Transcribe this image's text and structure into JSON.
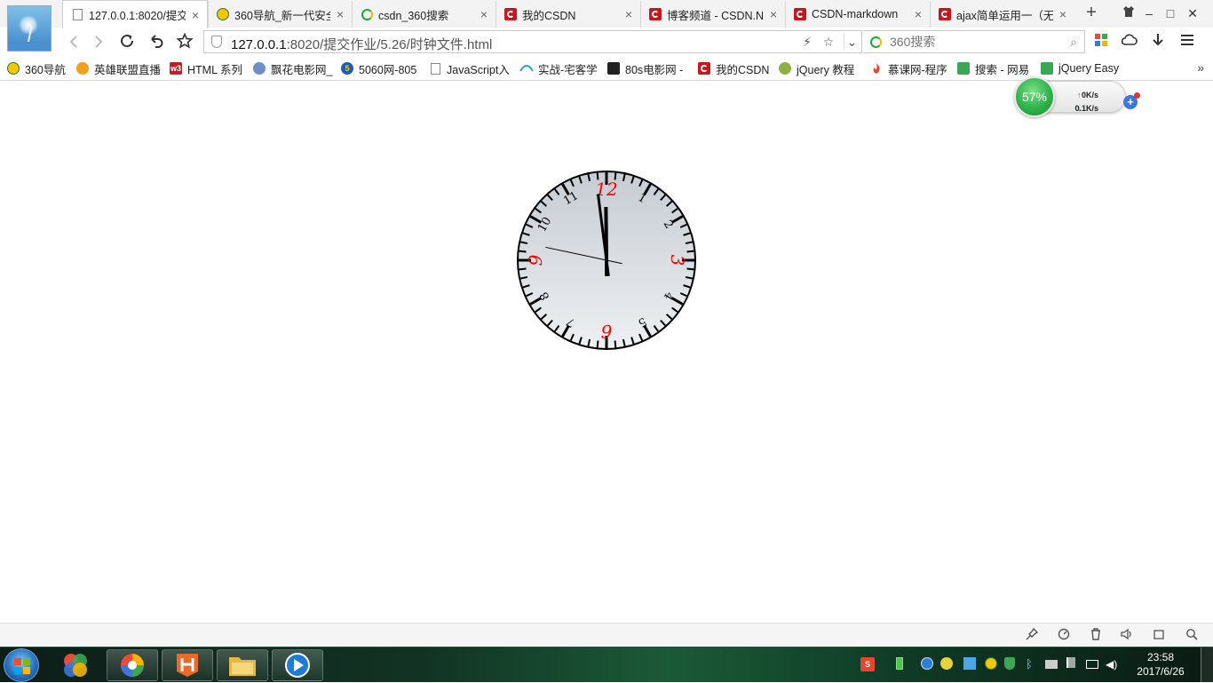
{
  "browser": {
    "tabs": [
      {
        "label": "127.0.0.1:8020/提交",
        "icon": "doc-icon",
        "active": true
      },
      {
        "label": "360导航_新一代安全",
        "icon": "360-nav-icon",
        "active": false
      },
      {
        "label": "csdn_360搜索",
        "icon": "360-search-icon",
        "active": false
      },
      {
        "label": "我的CSDN",
        "icon": "csdn-icon",
        "active": false
      },
      {
        "label": "博客频道 - CSDN.N",
        "icon": "csdn-icon",
        "active": false
      },
      {
        "label": "CSDN-markdown",
        "icon": "csdn-icon",
        "active": false
      },
      {
        "label": "ajax简单运用一（无",
        "icon": "csdn-icon",
        "active": false
      }
    ],
    "new_tab_label": "+",
    "window_controls": {
      "minimize": "–",
      "maximize": "□",
      "close": "✕"
    },
    "address": {
      "host": "127.0.0.1",
      "path": ":8020/提交作业/5.26/时钟文件.html"
    },
    "search": {
      "placeholder": "360搜索"
    },
    "bookmarks": [
      {
        "label": "360导航",
        "icon": "360-nav-icon"
      },
      {
        "label": "英雄联盟直播",
        "icon": "lol-icon"
      },
      {
        "label": "HTML 系列",
        "icon": "w3-icon"
      },
      {
        "label": "飘花电影网_",
        "icon": "piaohua-icon"
      },
      {
        "label": "5060网-805",
        "icon": "5060-icon"
      },
      {
        "label": "JavaScript入",
        "icon": "page-icon"
      },
      {
        "label": "实战-宅客学",
        "icon": "zhaike-icon"
      },
      {
        "label": "80s电影网 -",
        "icon": "film-icon"
      },
      {
        "label": "我的CSDN",
        "icon": "csdn-icon"
      },
      {
        "label": "jQuery 教程",
        "icon": "jquery-icon"
      },
      {
        "label": "慕课网-程序",
        "icon": "mooc-icon"
      },
      {
        "label": "搜索 - 网易",
        "icon": "netease-icon"
      },
      {
        "label": "jQuery Easy",
        "icon": "jquery-easy-icon"
      }
    ],
    "bookmarks_more": "»"
  },
  "speed_widget": {
    "percent": "57%",
    "upload": "0K/s",
    "download": "0.1K/s",
    "up_arrow": "↑",
    "down_arrow": "↓",
    "plus": "+"
  },
  "clock": {
    "numerals": [
      "12",
      "1",
      "2",
      "3",
      "4",
      "5",
      "6",
      "7",
      "8",
      "9",
      "10",
      "11"
    ],
    "highlight_numerals": [
      "12",
      "3",
      "6",
      "9"
    ],
    "highlight_color": "#ff0000",
    "time": {
      "hour": 11,
      "minute": 58,
      "second": 47
    }
  },
  "taskbar": {
    "tray_time": "23:58",
    "tray_date": "2017/6/26"
  },
  "colors": {
    "accent": "#c9151e",
    "clock_face_top": "#c5ccd3",
    "clock_face_bottom": "#eef0f2"
  }
}
